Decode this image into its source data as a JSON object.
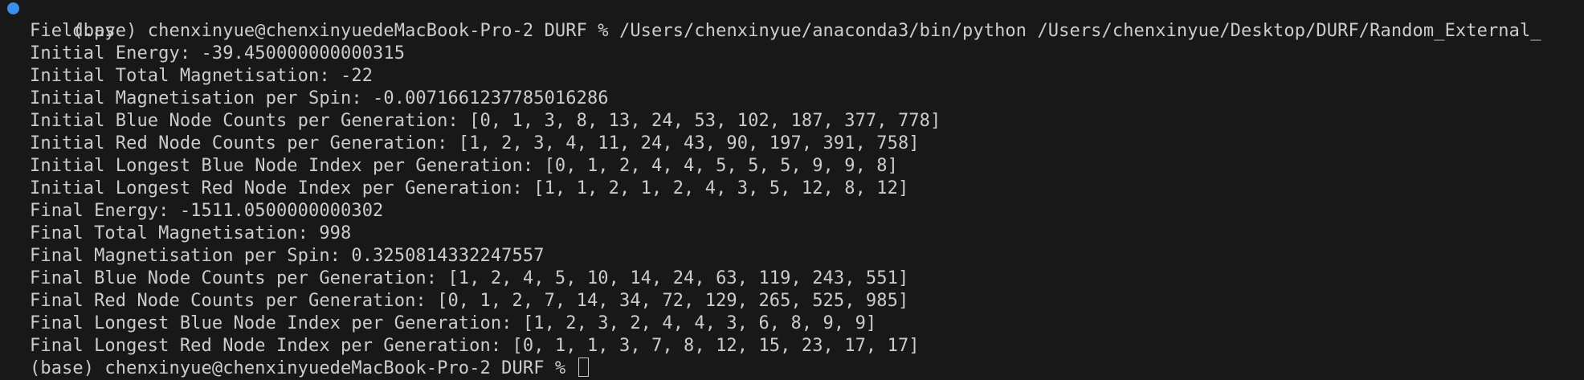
{
  "terminal": {
    "command_line": "(base) chenxinyue@chenxinyuedeMacBook-Pro-2 DURF % /Users/chenxinyue/anaconda3/bin/python /Users/chenxinyue/Desktop/DURF/Random_External_",
    "command_wrap": "Field.py",
    "status_color": "#3b8eea",
    "output_lines": [
      "Initial Energy: -39.450000000000315",
      "Initial Total Magnetisation: -22",
      "Initial Magnetisation per Spin: -0.0071661237785016286",
      "Initial Blue Node Counts per Generation: [0, 1, 3, 8, 13, 24, 53, 102, 187, 377, 778]",
      "Initial Red Node Counts per Generation: [1, 2, 3, 4, 11, 24, 43, 90, 197, 391, 758]",
      "Initial Longest Blue Node Index per Generation: [0, 1, 2, 4, 4, 5, 5, 5, 9, 9, 8]",
      "Initial Longest Red Node Index per Generation: [1, 1, 2, 1, 2, 4, 3, 5, 12, 8, 12]",
      "Final Energy: -1511.0500000000302",
      "Final Total Magnetisation: 998",
      "Final Magnetisation per Spin: 0.3250814332247557",
      "Final Blue Node Counts per Generation: [1, 2, 4, 5, 10, 14, 24, 63, 119, 243, 551]",
      "Final Red Node Counts per Generation: [0, 1, 2, 7, 14, 34, 72, 129, 265, 525, 985]",
      "Final Longest Blue Node Index per Generation: [1, 2, 3, 2, 4, 4, 3, 6, 8, 9, 9]",
      "Final Longest Red Node Index per Generation: [0, 1, 1, 3, 7, 8, 12, 15, 23, 17, 17]"
    ],
    "prompt_line": "(base) chenxinyue@chenxinyuedeMacBook-Pro-2 DURF % "
  }
}
